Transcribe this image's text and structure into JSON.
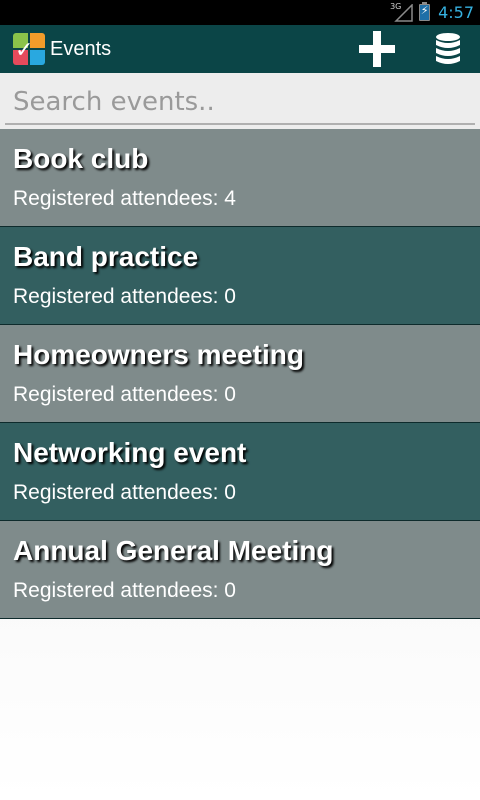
{
  "status_bar": {
    "network_type": "3G",
    "time": "4:57",
    "icons": [
      "signal-icon",
      "battery-charging-icon"
    ]
  },
  "action_bar": {
    "title": "Events",
    "app_icon": "app-logo-icon",
    "actions": [
      {
        "name": "add-event-button",
        "icon": "plus-icon"
      },
      {
        "name": "database-button",
        "icon": "database-icon"
      }
    ]
  },
  "search": {
    "placeholder": "Search events..",
    "value": ""
  },
  "events": [
    {
      "name": "Book club",
      "attendees_label": "Registered attendees: 4"
    },
    {
      "name": "Band practice",
      "attendees_label": "Registered attendees: 0"
    },
    {
      "name": "Homeowners meeting",
      "attendees_label": "Registered attendees: 0"
    },
    {
      "name": "Networking event",
      "attendees_label": "Registered attendees: 0"
    },
    {
      "name": "Annual General Meeting",
      "attendees_label": "Registered attendees: 0"
    }
  ],
  "colors": {
    "status_bar_bg": "#000000",
    "clock": "#36b1e0",
    "action_bar_bg": "#0b4547",
    "row_grey": "#7f8b8b",
    "row_teal": "#335f60"
  }
}
